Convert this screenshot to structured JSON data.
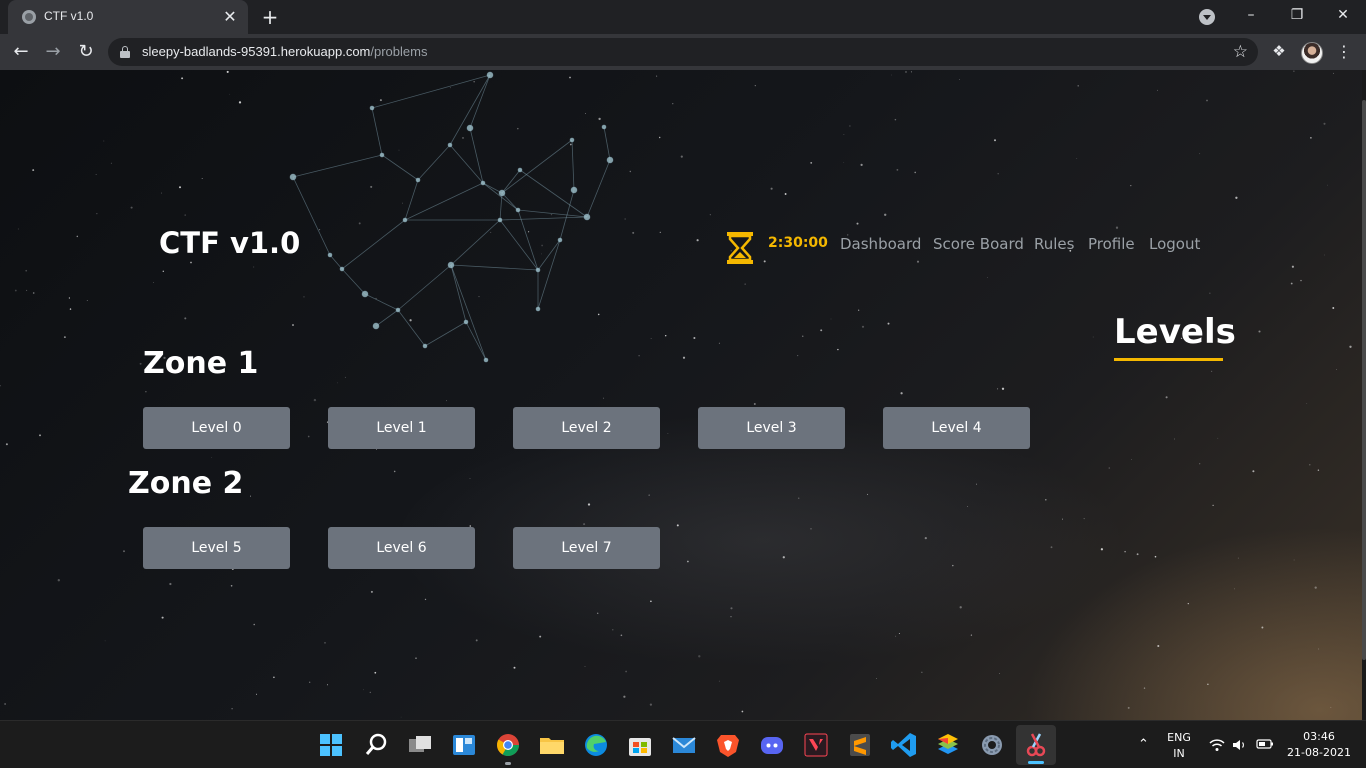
{
  "browser": {
    "tab_title": "CTF v1.0",
    "tab_close": "✕",
    "new_tab": "+",
    "url_host": "sleepy-badlands-95391.herokuapp.com",
    "url_path": "/problems",
    "icons": [
      "back-arrow-icon",
      "forward-arrow-icon",
      "reload-icon",
      "lock-icon",
      "star-icon",
      "extensions-icon",
      "profile-avatar",
      "menu-icon"
    ]
  },
  "site": {
    "title": "CTF v1.0",
    "timer": "2:30:00",
    "timer_color": "#f5b800",
    "nav": [
      "Dashboard",
      "Score Board",
      "Rules",
      "Profile",
      "Logout"
    ]
  },
  "levels_heading": "Levels",
  "accent": "#f5b800",
  "zones": [
    {
      "title": "Zone 1",
      "levels": [
        "Level 0",
        "Level 1",
        "Level 2",
        "Level 3",
        "Level 4"
      ]
    },
    {
      "title": "Zone 2",
      "levels": [
        "Level 5",
        "Level 6",
        "Level 7"
      ]
    }
  ],
  "taskbar": {
    "apps": [
      "windows-start-icon",
      "search-icon",
      "task-view-icon",
      "widgets-icon",
      "chrome-icon",
      "file-explorer-icon",
      "edge-icon",
      "microsoft-store-icon",
      "mail-icon",
      "brave-icon",
      "discord-icon",
      "valorant-icon",
      "sublime-text-icon",
      "vscode-icon",
      "bluestacks-icon",
      "settings-icon",
      "snipping-tool-icon"
    ],
    "lang_top": "ENG",
    "lang_bottom": "IN",
    "time": "03:46",
    "date": "21-08-2021"
  }
}
